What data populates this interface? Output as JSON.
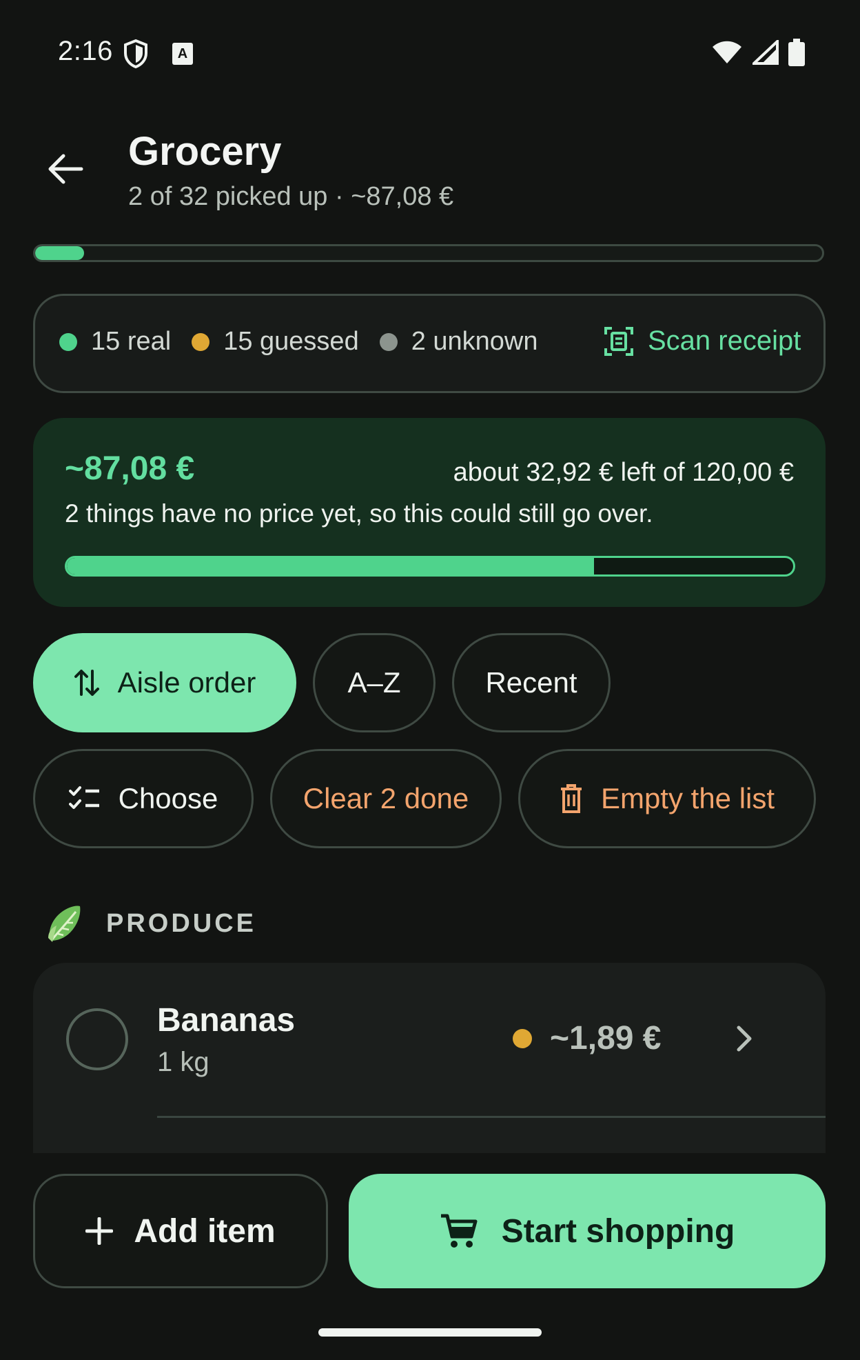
{
  "status_bar": {
    "time": "2:16",
    "icons": [
      "shield-icon",
      "keyboard-a-icon",
      "wifi-icon",
      "signal-icon",
      "battery-icon"
    ]
  },
  "header": {
    "title": "Grocery",
    "subtitle": "2 of 32 picked up · ~87,08 €",
    "picked_progress": 0.0625
  },
  "legend": {
    "real_label": "15 real",
    "guessed_label": "15 guessed",
    "unknown_label": "2 unknown",
    "scan_label": "Scan receipt",
    "colors": {
      "real": "#4fd38c",
      "guessed": "#e0a834",
      "unknown": "#8c948e"
    }
  },
  "budget": {
    "total": "~87,08 €",
    "left_text": "about 32,92 € left of 120,00 €",
    "note": "2 things have no price yet, so this could still go over.",
    "spent_fraction": 0.7257
  },
  "sort_chips": {
    "aisle_order": "Aisle order",
    "a_z": "A–Z",
    "recent": "Recent",
    "selected": "aisle_order"
  },
  "actions": {
    "choose": "Choose",
    "clear_done": "Clear 2 done",
    "empty_list": "Empty the list"
  },
  "section": {
    "title": "PRODUCE",
    "icon": "lettuce-icon"
  },
  "items": [
    {
      "name": "Bananas",
      "qty": "1 kg",
      "price": "~1,89 €",
      "price_status": "guessed",
      "checked": false
    }
  ],
  "bottom": {
    "add_item": "Add item",
    "start_shopping": "Start shopping"
  },
  "colors": {
    "accent": "#7de6ae",
    "accent_strong": "#4fd38c",
    "warning": "#f3a46d",
    "background": "#121412"
  }
}
